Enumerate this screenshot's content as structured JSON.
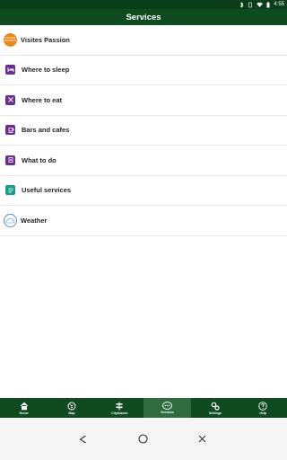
{
  "status_bar": {
    "time": "4:55"
  },
  "header": {
    "title": "Services"
  },
  "services": [
    {
      "label": "Visites Passion",
      "icon": "visites-passion-logo",
      "logo_text": [
        "VISITES",
        "PASSION"
      ]
    },
    {
      "label": "Where to sleep",
      "icon": "bed-icon"
    },
    {
      "label": "Where to eat",
      "icon": "cutlery-icon"
    },
    {
      "label": "Bars and cafes",
      "icon": "drink-icon"
    },
    {
      "label": "What to do",
      "icon": "activity-icon"
    },
    {
      "label": "Useful services",
      "icon": "info-icon"
    },
    {
      "label": "Weather",
      "icon": "cloud-icon"
    }
  ],
  "bottom_nav": [
    {
      "label": "Home",
      "icon": "home-icon"
    },
    {
      "label": "Map",
      "icon": "globe-icon"
    },
    {
      "label": "Cityhuides",
      "icon": "signpost-icon"
    },
    {
      "label": "Services",
      "icon": "more-icon",
      "active": true
    },
    {
      "label": "Settings",
      "icon": "gears-icon"
    },
    {
      "label": "Help",
      "icon": "help-icon"
    }
  ],
  "colors": {
    "primary": "#0f4a21",
    "statusbar": "#0b3d1a",
    "active_tab": "#2f6b3f",
    "purple": "#6b2c91",
    "teal": "#1a9a8b",
    "orange": "#e8891e"
  }
}
